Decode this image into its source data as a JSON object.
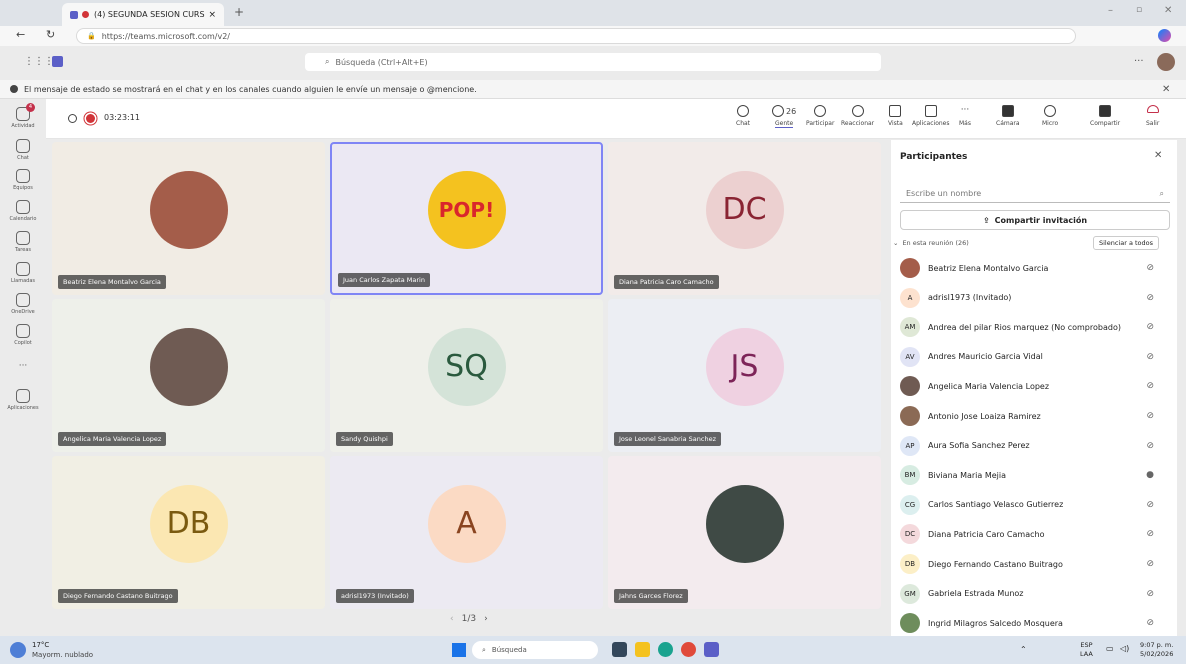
{
  "browser": {
    "tab_title": "(4) SEGUNDA SESION CURS",
    "url": "https://teams.microsoft.com/v2/"
  },
  "teams": {
    "search_placeholder": "Búsqueda (Ctrl+Alt+E)",
    "notice": "El mensaje de estado se mostrará en el chat y en los canales cuando alguien le envíe un mensaje o @mencione."
  },
  "rail": [
    {
      "label": "Actividad",
      "icon": "bell-icon",
      "badge": "4"
    },
    {
      "label": "Chat",
      "icon": "chat-icon"
    },
    {
      "label": "Equipos",
      "icon": "teams-icon"
    },
    {
      "label": "Calendario",
      "icon": "calendar-icon"
    },
    {
      "label": "Tareas",
      "icon": "tasks-icon"
    },
    {
      "label": "Llamadas",
      "icon": "phone-icon"
    },
    {
      "label": "OneDrive",
      "icon": "cloud-icon"
    },
    {
      "label": "Copilot",
      "icon": "copilot-icon"
    },
    {
      "label": "Aplicaciones",
      "icon": "apps-icon"
    }
  ],
  "meeting": {
    "timer": "03:23:11",
    "people_count": "26",
    "toolbar": [
      {
        "label": "Chat",
        "icon": "chat-icon"
      },
      {
        "label": "Gente",
        "icon": "people-icon"
      },
      {
        "label": "Participar",
        "icon": "hand-icon"
      },
      {
        "label": "Reaccionar",
        "icon": "emoji-icon"
      },
      {
        "label": "Vista",
        "icon": "grid-icon"
      },
      {
        "label": "Aplicaciones",
        "icon": "add-app-icon"
      },
      {
        "label": "Más",
        "icon": "more-icon"
      },
      {
        "label": "Cámara",
        "icon": "camera-off-icon"
      },
      {
        "label": "Micro",
        "icon": "mic-off-icon"
      },
      {
        "label": "Compartir",
        "icon": "share-icon"
      },
      {
        "label": "Salir",
        "icon": "hangup-icon"
      }
    ]
  },
  "tiles": [
    {
      "name": "Beatriz Elena Montalvo Garcia",
      "initials": "",
      "avatar_color": "#a45d4a",
      "bg": "#f1ece4"
    },
    {
      "name": "Juan Carlos Zapata Marin",
      "initials": "POP!",
      "avatar_color": "#f4c21f",
      "bg": "#ebe8f3"
    },
    {
      "name": "Diana Patricia Caro Camacho",
      "initials": "DC",
      "avatar_color": "#ecd0d0",
      "bg": "#f2ebe9"
    },
    {
      "name": "Angelica Maria Valencia Lopez",
      "initials": "",
      "avatar_color": "#6f5b53",
      "bg": "#eef0ea"
    },
    {
      "name": "Sandy Quishpi",
      "initials": "SQ",
      "avatar_color": "#d4e3d8",
      "bg": "#eff0ea"
    },
    {
      "name": "Jose Leonel Sanabria Sanchez",
      "initials": "JS",
      "avatar_color": "#efd1e1",
      "bg": "#eceef3"
    },
    {
      "name": "Diego Fernando Castano Buitrago",
      "initials": "DB",
      "avatar_color": "#fbe7b2",
      "bg": "#f1efe4"
    },
    {
      "name": "adrisl1973 (Invitado)",
      "initials": "A",
      "avatar_color": "#fbdac4",
      "bg": "#eceaf2"
    },
    {
      "name": "Jahns Garces Florez",
      "initials": "",
      "avatar_color": "#3f4a45",
      "bg": "#f3ebee"
    }
  ],
  "pager": "1/3",
  "panel": {
    "title": "Participantes",
    "search_placeholder": "Escribe un nombre",
    "invite_label": "Compartir invitación",
    "section_label": "En esta reunión (26)",
    "mute_all_label": "Silenciar a todos",
    "participants": [
      {
        "name": "Beatriz Elena Montalvo Garcia",
        "initials": "",
        "color": "#a45d4a"
      },
      {
        "name": "adrisl1973 (Invitado)",
        "initials": "A",
        "color": "#fde2cf"
      },
      {
        "name": "Andrea del pilar Rios marquez (No comprobado)",
        "initials": "AM",
        "color": "#dfe8d6"
      },
      {
        "name": "Andres Mauricio Garcia Vidal",
        "initials": "AV",
        "color": "#e1e4f5"
      },
      {
        "name": "Angelica Maria Valencia Lopez",
        "initials": "",
        "color": "#6f5b53"
      },
      {
        "name": "Antonio Jose Loaiza Ramirez",
        "initials": "",
        "color": "#8b6a55"
      },
      {
        "name": "Aura Sofia Sanchez Perez",
        "initials": "AP",
        "color": "#dfe7f6"
      },
      {
        "name": "Biviana Maria Mejia",
        "initials": "BM",
        "color": "#d7ece2"
      },
      {
        "name": "Carlos Santiago Velasco Gutierrez",
        "initials": "CG",
        "color": "#dcefef"
      },
      {
        "name": "Diana Patricia Caro Camacho",
        "initials": "DC",
        "color": "#f4d9dc"
      },
      {
        "name": "Diego Fernando Castano Buitrago",
        "initials": "DB",
        "color": "#fcefc7"
      },
      {
        "name": "Gabriela Estrada Munoz",
        "initials": "GM",
        "color": "#dde9dc"
      },
      {
        "name": "Ingrid Milagros Salcedo Mosquera",
        "initials": "",
        "color": "#6e8d5c"
      }
    ]
  },
  "taskbar": {
    "temp": "17°C",
    "weather": "Mayorm. nublado",
    "search": "Búsqueda",
    "lang1": "ESP",
    "lang2": "LAA",
    "time": "9:07 p. m.",
    "date": "5/02/2026"
  }
}
